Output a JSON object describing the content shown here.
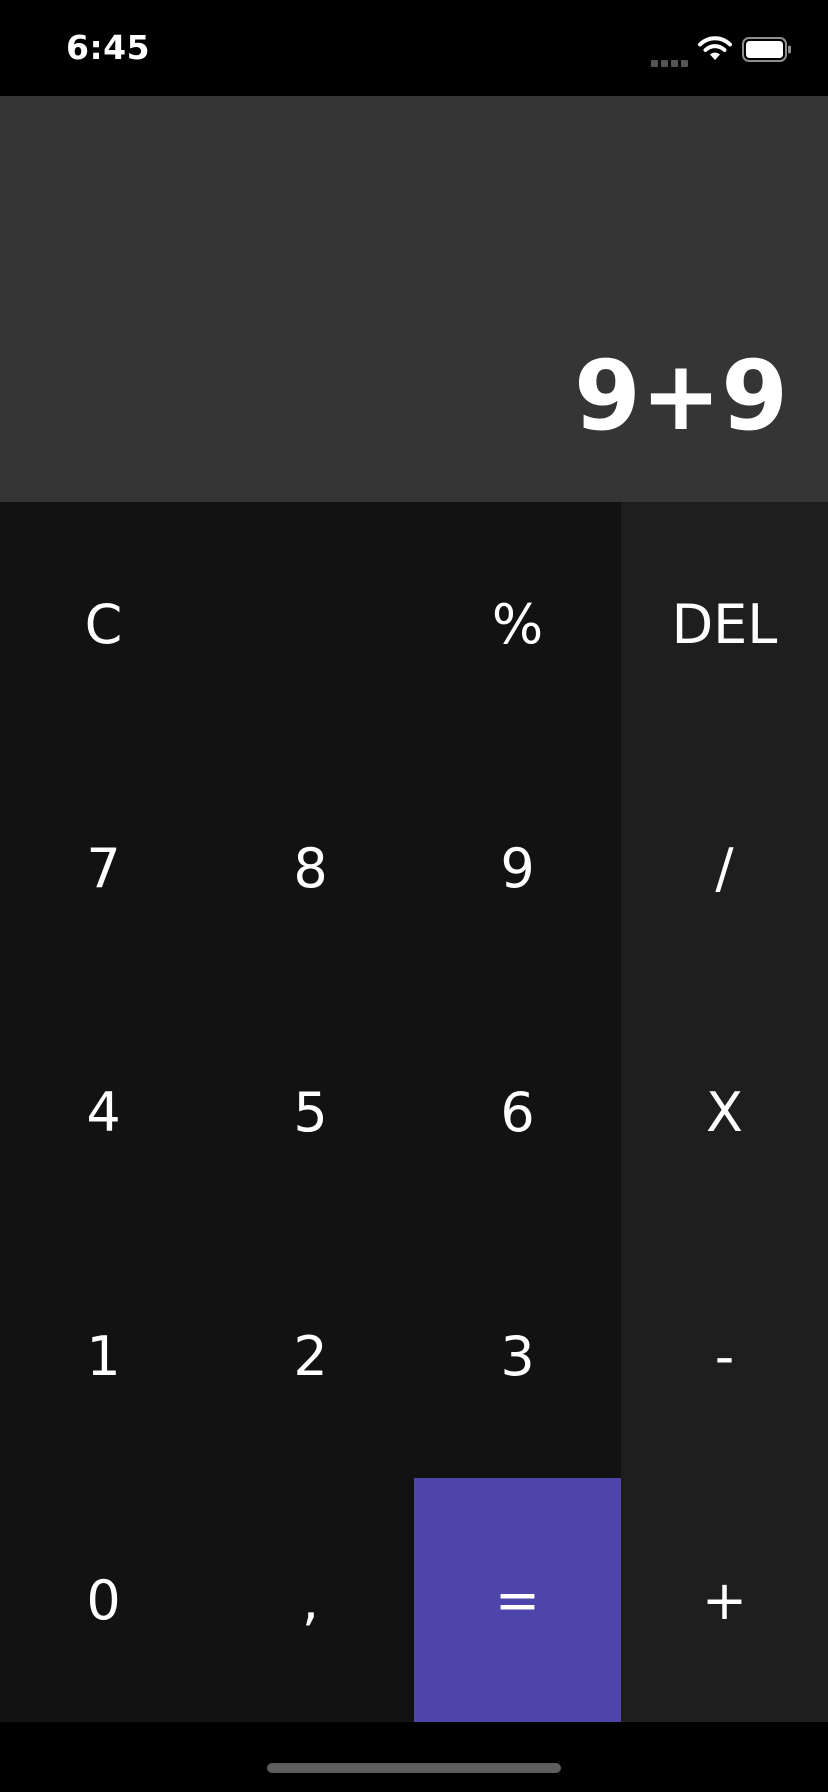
{
  "status_bar": {
    "time": "6:45",
    "signal_icon": "cellular-signal-icon",
    "wifi_icon": "wifi-icon",
    "battery_icon": "battery-icon"
  },
  "display": {
    "expression": "9+9"
  },
  "keys": {
    "clear": "C",
    "percent": "%",
    "delete": "DEL",
    "seven": "7",
    "eight": "8",
    "nine": "9",
    "divide": "/",
    "four": "4",
    "five": "5",
    "six": "6",
    "multiply": "X",
    "one": "1",
    "two": "2",
    "three": "3",
    "minus": "-",
    "zero": "0",
    "comma": ",",
    "equals": "=",
    "plus": "+"
  },
  "colors": {
    "display_bg": "#353535",
    "key_bg": "#121212",
    "operator_bg": "#1e1e1e",
    "equals_bg": "#4e45ab",
    "text": "#ffffff"
  }
}
